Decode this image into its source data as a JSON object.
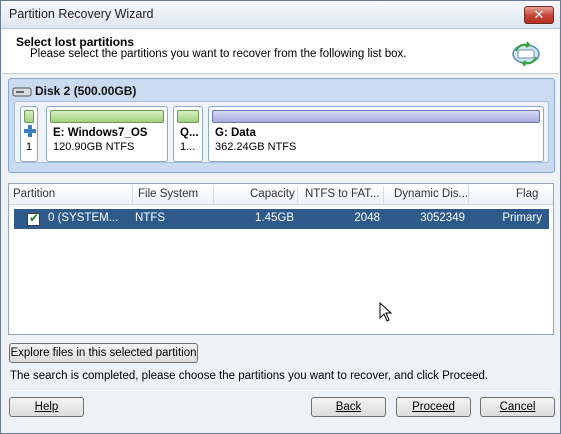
{
  "window": {
    "title": "Partition Recovery Wizard",
    "close_label": "✕"
  },
  "header": {
    "title": "Select lost partitions",
    "subtitle": "Please select the partitions you want to recover from the following list box."
  },
  "disk": {
    "label": "Disk 2 (500.00GB)",
    "partitions": [
      {
        "name": "",
        "size": "1",
        "bar_color": "#9fd27d"
      },
      {
        "name": "E: Windows7_OS",
        "size": "120.90GB NTFS",
        "bar_color": "#9fd27d"
      },
      {
        "name": "Q...",
        "size": "1...",
        "bar_color": "#9fd27d"
      },
      {
        "name": "G: Data",
        "size": "362.24GB NTFS",
        "bar_color": "#a7abe0"
      }
    ]
  },
  "table": {
    "columns": [
      "Partition",
      "File System",
      "Capacity",
      "NTFS to FAT...",
      "Dynamic Dis...",
      "Flag"
    ],
    "rows": [
      {
        "checked": true,
        "partition": "0 (SYSTEM...",
        "file_system": "NTFS",
        "capacity": "1.45GB",
        "ntfs_to_fat": "2048",
        "dynamic_disk": "3052349",
        "flag": "Primary"
      }
    ]
  },
  "explore_button": "Explore files in this selected partition",
  "status_text": "The search is completed, please choose the partitions you want to recover, and click Proceed.",
  "footer": {
    "help": "Help",
    "back": "Back",
    "proceed": "Proceed",
    "cancel": "Cancel"
  },
  "colors": {
    "selection": "#2d5a8a",
    "disk_panel": "#c9daf1",
    "close_red": "#c7443a"
  }
}
